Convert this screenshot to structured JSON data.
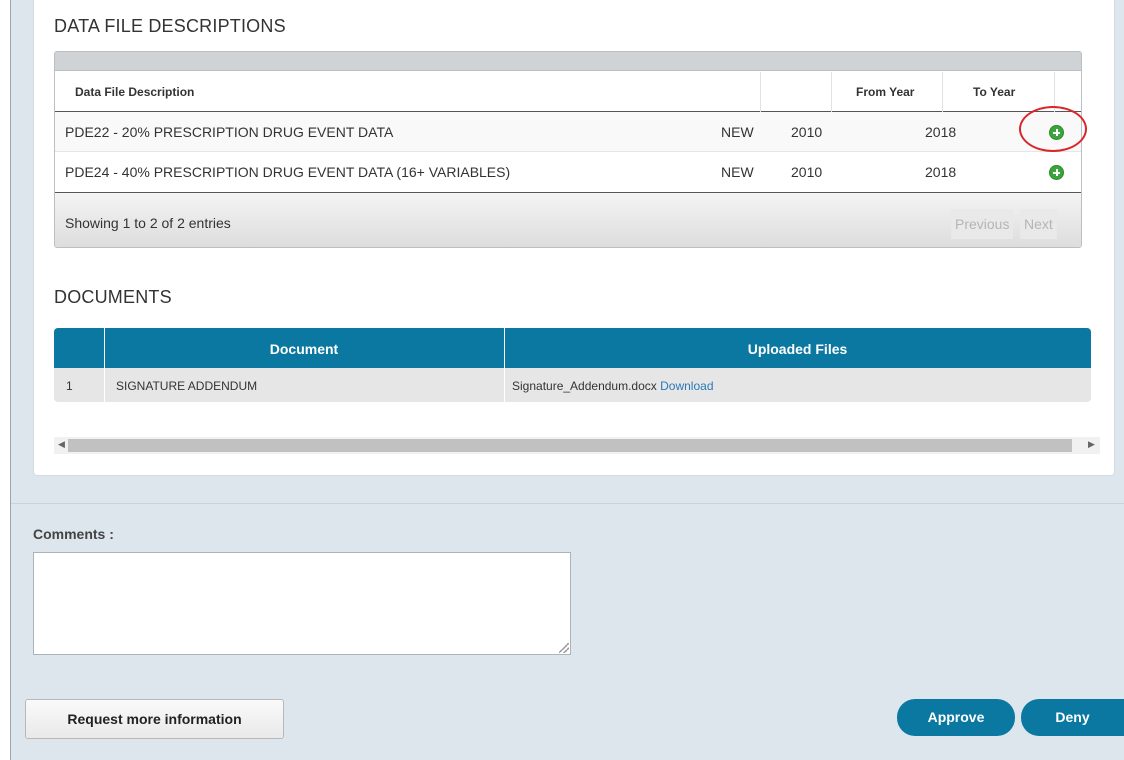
{
  "data_files": {
    "title": "DATA FILE DESCRIPTIONS",
    "columns": [
      "Data File Description",
      "From Year",
      "To Year"
    ],
    "rows": [
      {
        "description": "PDE22 - 20% PRESCRIPTION DRUG EVENT DATA",
        "status": "NEW",
        "from_year": "2010",
        "to_year": "2018",
        "icon": "add-circle-icon"
      },
      {
        "description": "PDE24 - 40% PRESCRIPTION DRUG EVENT DATA (16+ VARIABLES)",
        "status": "NEW",
        "from_year": "2010",
        "to_year": "2018",
        "icon": "add-circle-icon"
      }
    ],
    "footer_info": "Showing 1 to 2 of 2 entries",
    "pager": {
      "previous": "Previous",
      "next": "Next"
    }
  },
  "documents": {
    "title": "DOCUMENTS",
    "columns": [
      "Document",
      "Uploaded Files"
    ],
    "rows": [
      {
        "index": "1",
        "document": "SIGNATURE ADDENDUM",
        "file": "Signature_Addendum.docx",
        "link": "Download"
      }
    ]
  },
  "comments": {
    "label": "Comments :",
    "value": ""
  },
  "actions": {
    "request_info": "Request more information",
    "approve": "Approve",
    "deny": "Deny"
  },
  "colors": {
    "accent": "#0a78a0",
    "add_icon": "#3aa53a",
    "highlight": "#d9262b",
    "link": "#2a79b8"
  }
}
